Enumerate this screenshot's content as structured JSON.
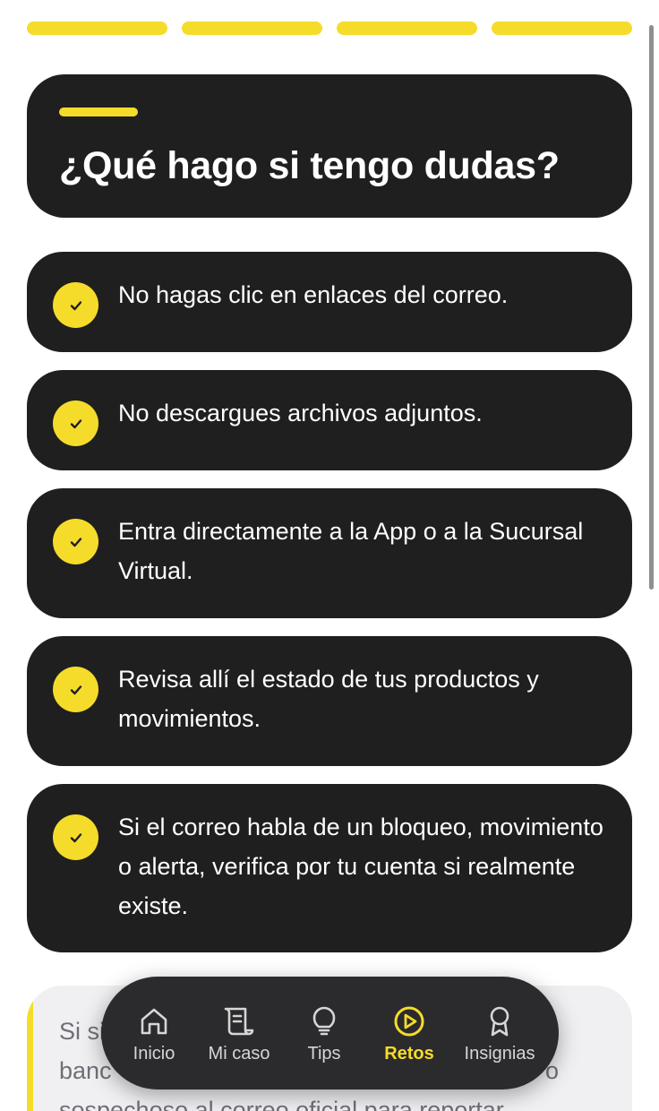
{
  "colors": {
    "accent": "#f5dc2a",
    "card": "#1f1f1f",
    "nav": "#2b2b2d",
    "text_light": "#ffffff",
    "muted": "#6f6f78"
  },
  "progress": {
    "segments": 4,
    "completed": 4
  },
  "header": {
    "title": "¿Qué hago si tengo dudas?"
  },
  "tips": [
    {
      "text": "No hagas clic en enlaces del correo.",
      "icon": "check-icon"
    },
    {
      "text": "No descargues archivos adjuntos.",
      "icon": "check-icon"
    },
    {
      "text": "Entra directamente a la App o a la Sucursal Virtual.",
      "icon": "check-icon"
    },
    {
      "text": "Revisa allí el estado de tus productos y movimientos.",
      "icon": "check-icon"
    },
    {
      "text": "Si el correo habla de un bloqueo, movimiento o alerta, verifica por tu cuenta si realmente existe.",
      "icon": "check-icon"
    }
  ],
  "info_card": {
    "line1": "Si si",
    "line2": "banc",
    "line2_end": "o",
    "line3": "sospechoso al correo oficial para reportar"
  },
  "nav": {
    "items": [
      {
        "label": "Inicio",
        "icon": "home-icon",
        "active": false
      },
      {
        "label": "Mi caso",
        "icon": "scroll-icon",
        "active": false
      },
      {
        "label": "Tips",
        "icon": "lightbulb-icon",
        "active": false
      },
      {
        "label": "Retos",
        "icon": "play-circle-icon",
        "active": true
      },
      {
        "label": "Insignias",
        "icon": "badge-icon",
        "active": false
      }
    ]
  }
}
